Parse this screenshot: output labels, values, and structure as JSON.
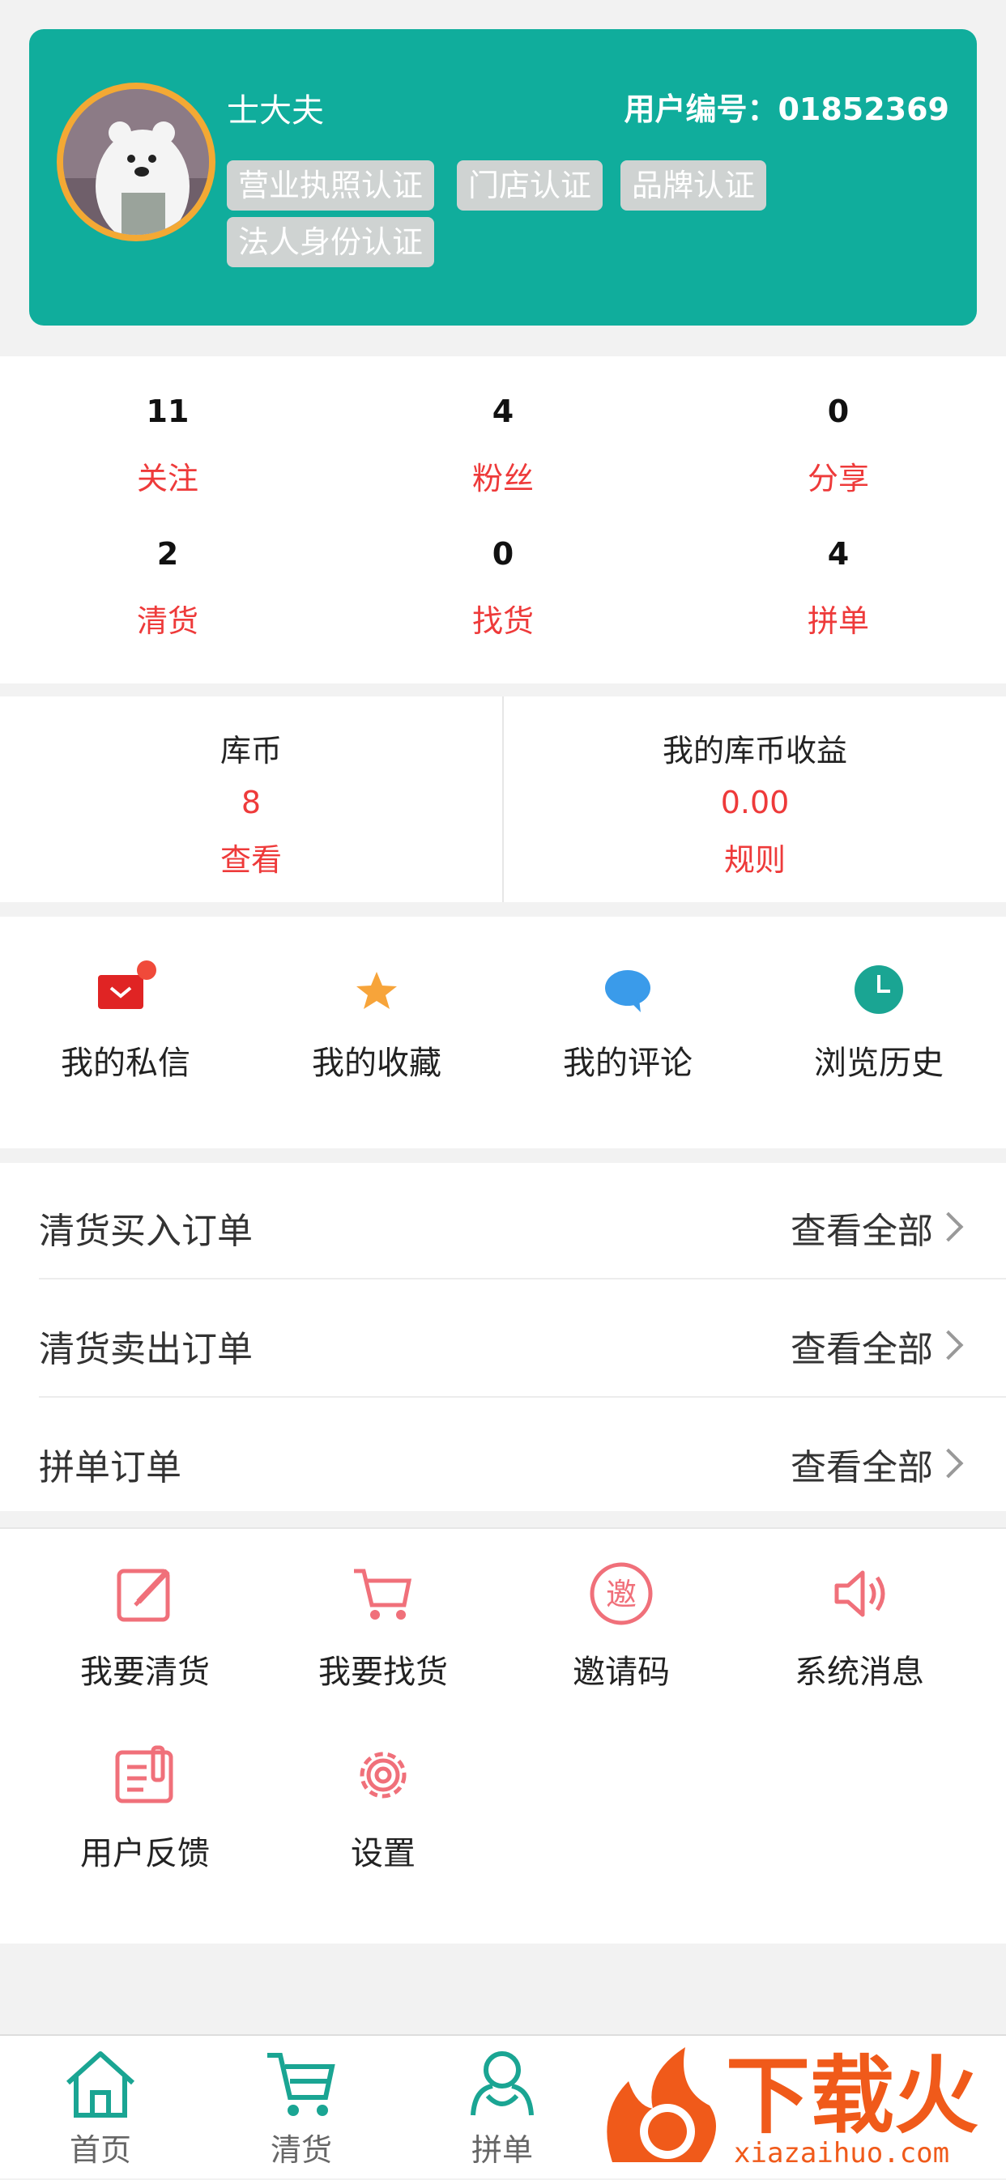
{
  "profile": {
    "username": "士大夫",
    "user_id": "用户编号：01852369",
    "badges": [
      "营业执照认证",
      "门店认证",
      "品牌认证",
      "法人身份认证"
    ]
  },
  "stats": [
    {
      "num": "11",
      "label": "关注"
    },
    {
      "num": "4",
      "label": "粉丝"
    },
    {
      "num": "0",
      "label": "分享"
    },
    {
      "num": "2",
      "label": "清货"
    },
    {
      "num": "0",
      "label": "找货"
    },
    {
      "num": "4",
      "label": "拼单"
    }
  ],
  "coins": {
    "left": {
      "title": "库币",
      "value": "8",
      "link": "查看"
    },
    "right": {
      "title": "我的库币收益",
      "value": "0.00",
      "link": "规则"
    }
  },
  "quick": [
    {
      "label": "我的私信",
      "icon": "mail-icon"
    },
    {
      "label": "我的收藏",
      "icon": "star-icon"
    },
    {
      "label": "我的评论",
      "icon": "comment-icon"
    },
    {
      "label": "浏览历史",
      "icon": "clock-icon"
    }
  ],
  "orders": [
    {
      "title": "清货买入订单",
      "action": "查看全部"
    },
    {
      "title": "清货卖出订单",
      "action": "查看全部"
    },
    {
      "title": "拼单订单",
      "action": "查看全部"
    }
  ],
  "grid": [
    {
      "label": "我要清货",
      "icon": "edit-icon"
    },
    {
      "label": "我要找货",
      "icon": "cart-icon"
    },
    {
      "label": "邀请码",
      "icon": "invite-icon",
      "glyph": "邀"
    },
    {
      "label": "系统消息",
      "icon": "speaker-icon"
    },
    {
      "label": "用户反馈",
      "icon": "feedback-icon"
    },
    {
      "label": "设置",
      "icon": "gear-icon"
    }
  ],
  "tabs": [
    {
      "label": "首页",
      "icon": "home-icon"
    },
    {
      "label": "清货",
      "icon": "cart-icon"
    },
    {
      "label": "拼单",
      "icon": "group-icon"
    }
  ],
  "watermark": {
    "brand": "下载火",
    "url": "xiazaihuo.com"
  },
  "colors": {
    "primary": "#10ad9c",
    "accent_red": "#ee3a3a",
    "icon_pink": "#f0707a",
    "avatar_ring": "#f3a934"
  }
}
